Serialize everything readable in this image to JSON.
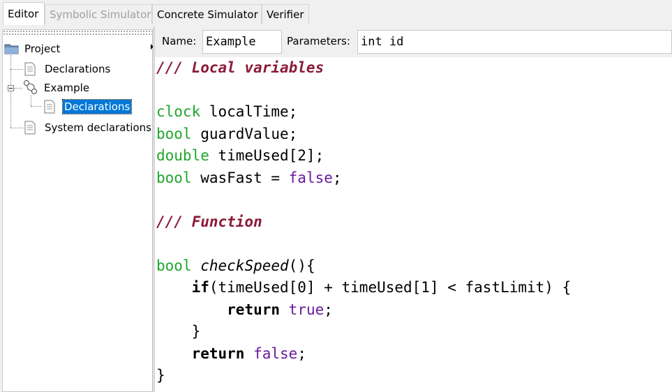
{
  "tabs": [
    {
      "label": "Editor",
      "state": "active"
    },
    {
      "label": "Symbolic Simulator",
      "state": "disabled"
    },
    {
      "label": "Concrete Simulator",
      "state": "normal"
    },
    {
      "label": "Verifier",
      "state": "normal"
    }
  ],
  "tree": {
    "project": "Project",
    "declarations": "Declarations",
    "template": "Example",
    "template_declarations": "Declarations",
    "system_declarations": "System declarations",
    "selected": "template_declarations"
  },
  "toolbar": {
    "name_label": "Name:",
    "name_value": "Example",
    "params_label": "Parameters:",
    "params_value": "int id"
  },
  "code": {
    "lines": [
      [
        {
          "t": "/// Local variables",
          "c": "cmt"
        }
      ],
      [],
      [
        {
          "t": "clock",
          "c": "typ"
        },
        {
          "t": " localTime;"
        }
      ],
      [
        {
          "t": "bool",
          "c": "typ"
        },
        {
          "t": " guardValue;"
        }
      ],
      [
        {
          "t": "double",
          "c": "typ"
        },
        {
          "t": " timeUsed[2];"
        }
      ],
      [
        {
          "t": "bool",
          "c": "typ"
        },
        {
          "t": " wasFast = "
        },
        {
          "t": "false",
          "c": "lit"
        },
        {
          "t": ";"
        }
      ],
      [],
      [
        {
          "t": "/// Function",
          "c": "cmt"
        }
      ],
      [],
      [
        {
          "t": "bool",
          "c": "typ"
        },
        {
          "t": " "
        },
        {
          "t": "checkSpeed",
          "c": "fn"
        },
        {
          "t": "(){"
        }
      ],
      [
        {
          "t": "    "
        },
        {
          "t": "if",
          "c": "kw"
        },
        {
          "t": "(timeUsed[0] + timeUsed[1] < fastLimit) {"
        }
      ],
      [
        {
          "t": "        "
        },
        {
          "t": "return",
          "c": "kw"
        },
        {
          "t": " "
        },
        {
          "t": "true",
          "c": "lit"
        },
        {
          "t": ";"
        }
      ],
      [
        {
          "t": "    }"
        }
      ],
      [
        {
          "t": "    "
        },
        {
          "t": "return",
          "c": "kw"
        },
        {
          "t": " "
        },
        {
          "t": "false",
          "c": "lit"
        },
        {
          "t": ";"
        }
      ],
      [
        {
          "t": "}"
        }
      ]
    ]
  }
}
